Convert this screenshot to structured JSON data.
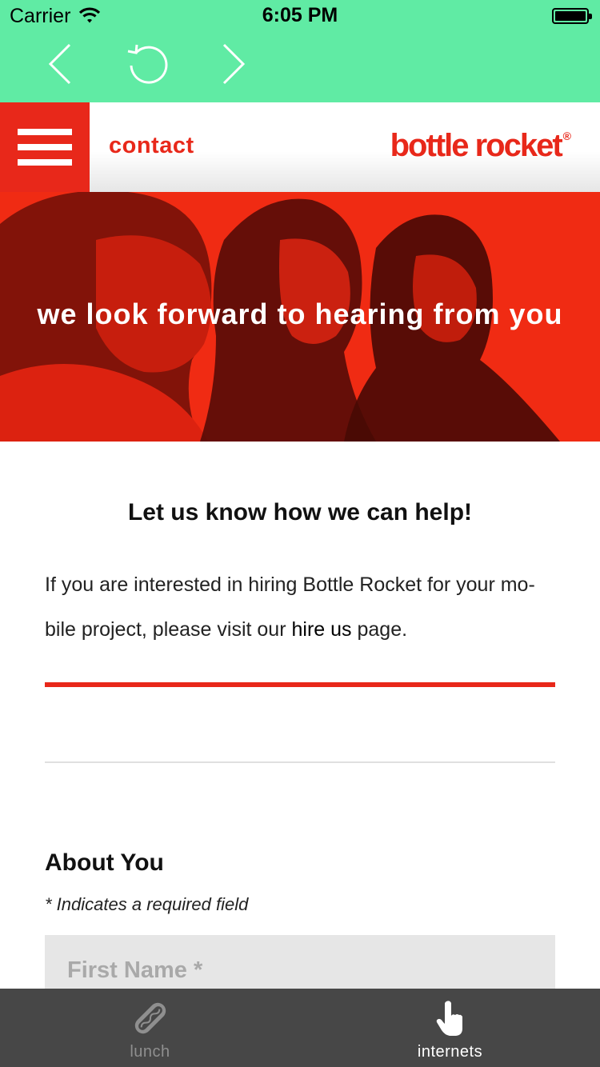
{
  "status_bar": {
    "carrier": "Carrier",
    "time": "6:05 PM"
  },
  "browser_toolbar": {
    "back_icon": "chevron-left-icon",
    "reload_icon": "reload-icon",
    "forward_icon": "chevron-right-icon",
    "color": "#60eba4"
  },
  "header": {
    "page_label": "contact",
    "logo_text": "bottle rocket",
    "logo_reg_mark": "®",
    "accent_color": "#e8281a"
  },
  "hero": {
    "headline": "we look forward to hearing from you"
  },
  "main": {
    "help_title": "Let us know how we can help!",
    "intro_before": "If you are interested in hiring Bottle Rocket for your mo-bile project, please visit our ",
    "intro_link": "hire us",
    "intro_after": " page."
  },
  "form": {
    "section_title": "About You",
    "required_note": "* Indicates a required field",
    "first_name_placeholder": "First Name *"
  },
  "tab_bar": {
    "tabs": [
      {
        "label": "lunch",
        "icon": "hotdog-icon",
        "selected": false
      },
      {
        "label": "internets",
        "icon": "pointing-hand-icon",
        "selected": true
      }
    ]
  }
}
